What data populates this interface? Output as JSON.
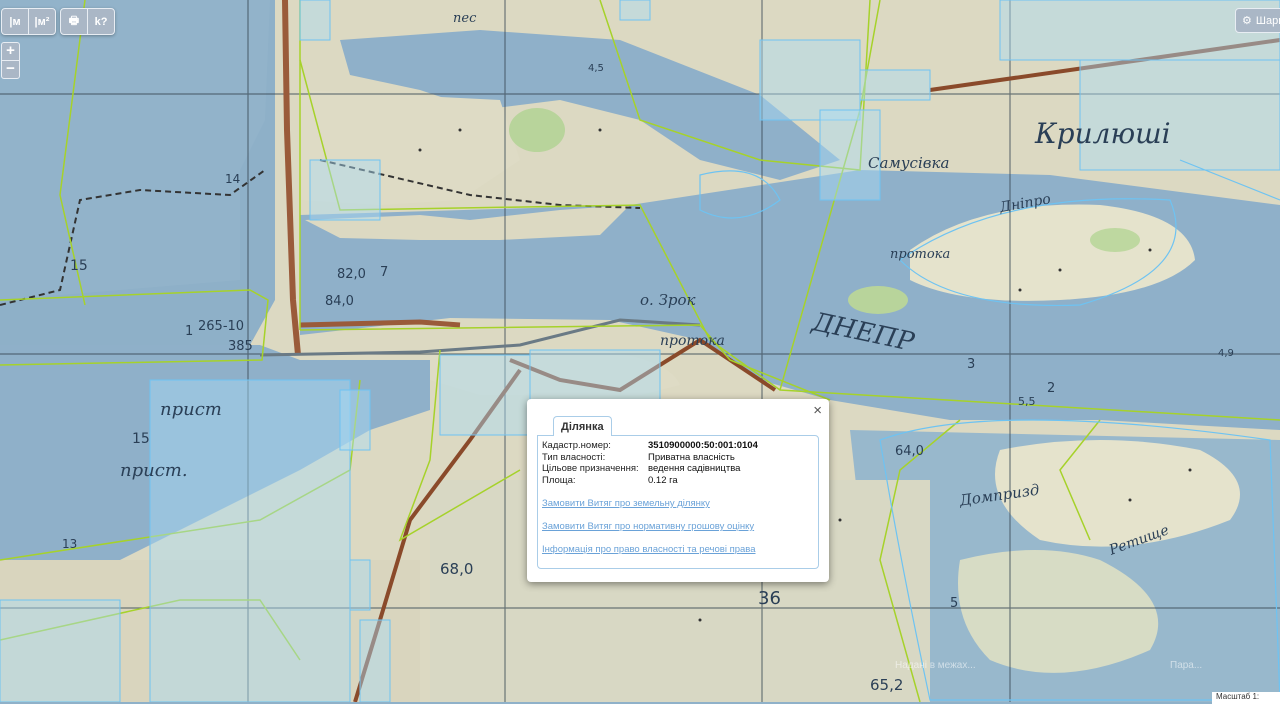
{
  "toolbar": {
    "measure_line_label": "|м",
    "measure_area_label": "|м²",
    "print_label": "🖶",
    "identify_label": "k?"
  },
  "zoom": {
    "in": "+",
    "out": "−"
  },
  "layers_button": {
    "label": "Шари"
  },
  "map_labels": [
    {
      "text": "Самусівка"
    },
    {
      "text": "Крилюші"
    },
    {
      "text": "ДНЕПР"
    },
    {
      "text": "прист"
    },
    {
      "text": "прист."
    },
    {
      "text": "пес"
    },
    {
      "text": "о. Зрок"
    },
    {
      "text": "протока"
    },
    {
      "text": "Дніпро"
    },
    {
      "text": "протока"
    },
    {
      "text": "Домпризд"
    },
    {
      "text": "Ретище"
    },
    {
      "text": "265-10"
    },
    {
      "text": "385"
    },
    {
      "text": "82,0"
    },
    {
      "text": "84,0"
    },
    {
      "text": "68,0"
    },
    {
      "text": "64,0"
    },
    {
      "text": "65,2"
    },
    {
      "text": "36"
    },
    {
      "text": "4,5"
    },
    {
      "text": "4,9"
    },
    {
      "text": "5,5"
    },
    {
      "text": "15"
    },
    {
      "text": "15"
    },
    {
      "text": "14"
    },
    {
      "text": "13"
    },
    {
      "text": "7"
    },
    {
      "text": "2"
    },
    {
      "text": "3"
    },
    {
      "text": "1"
    },
    {
      "text": "5"
    }
  ],
  "popup": {
    "tab_label": "Ділянка",
    "close_label": "×",
    "fields": [
      {
        "label": "Кадастр.номер:",
        "value": "3510900000:50:001:0104"
      },
      {
        "label": "Тип власності:",
        "value": "Приватна власність"
      },
      {
        "label": "Цільове призначення:",
        "value": "ведення садівництва"
      },
      {
        "label": "Площа:",
        "value": "0.12 га"
      }
    ],
    "links": [
      "Замовити Витяг про земельну ділянку",
      "Замовити Витяг про нормативну грошову оцінку",
      "Інформація про право власності та речові права"
    ]
  },
  "scale": {
    "label": "Масштаб 1:"
  },
  "watermark": {
    "text1": "Надані в межах...",
    "text2": "Пара..."
  }
}
